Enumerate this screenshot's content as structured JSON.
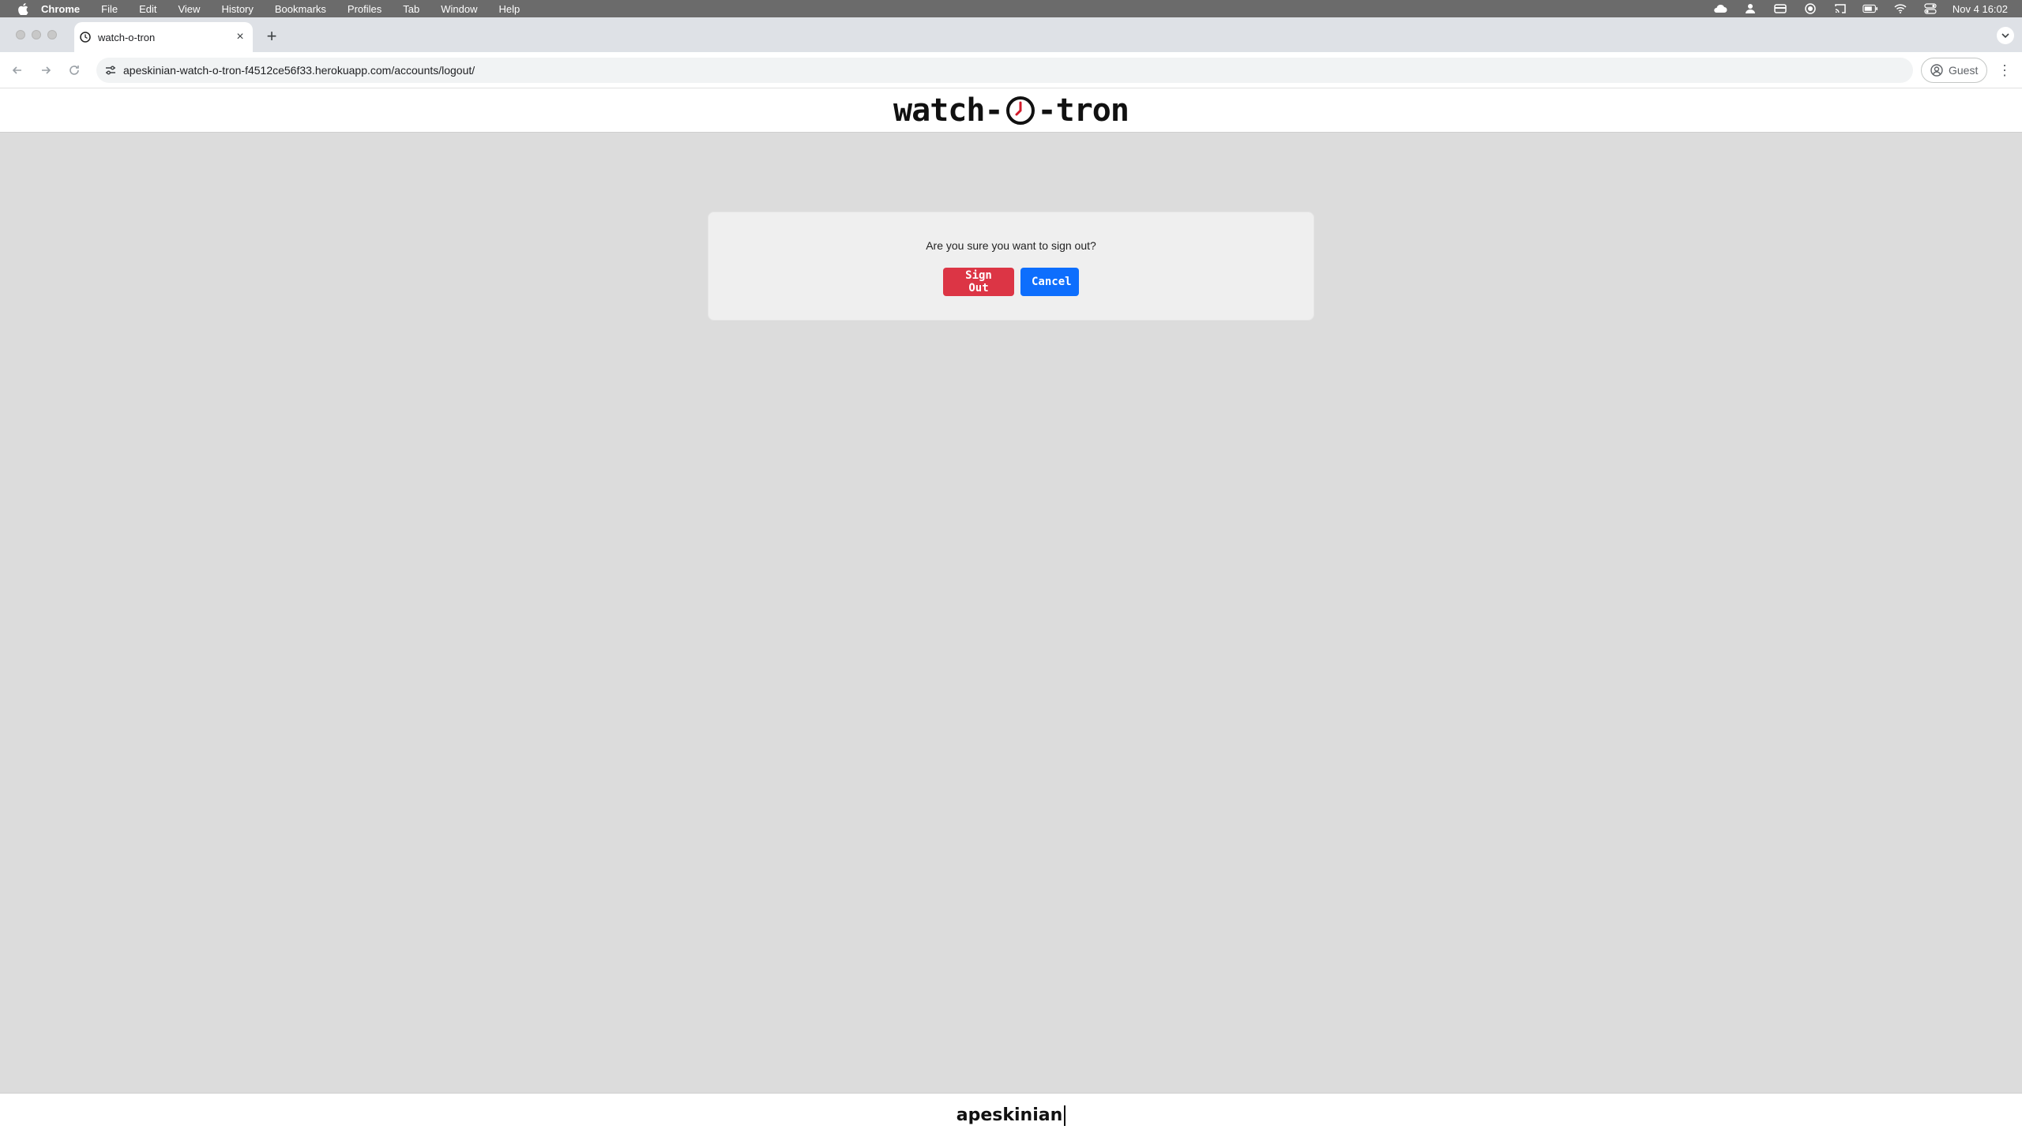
{
  "menubar": {
    "app": "Chrome",
    "items": [
      "File",
      "Edit",
      "View",
      "History",
      "Bookmarks",
      "Profiles",
      "Tab",
      "Window",
      "Help"
    ],
    "clock": "Nov 4  16:02",
    "status_icons": [
      "cloud-icon",
      "user-cloud-icon",
      "card-icon",
      "record-icon",
      "cast-icon",
      "battery-icon",
      "wifi-icon",
      "control-center-icon"
    ]
  },
  "tabs": [
    {
      "title": "watch-o-tron",
      "icon": "clock-favicon-icon"
    }
  ],
  "toolbar": {
    "url": "apeskinian-watch-o-tron-f4512ce56f33.herokuapp.com/accounts/logout/",
    "profile_label": "Guest"
  },
  "site": {
    "logo_left": "watch-",
    "logo_right": "-tron"
  },
  "dialog": {
    "question": "Are you sure you want to sign out?",
    "signout_label": "Sign Out",
    "cancel_label": "Cancel"
  },
  "footer": {
    "username": "apeskinian"
  },
  "colors": {
    "danger": "#dc3545",
    "primary": "#0d6efd",
    "background": "#dcdcdc",
    "logo_hand": "#d11a2a"
  }
}
